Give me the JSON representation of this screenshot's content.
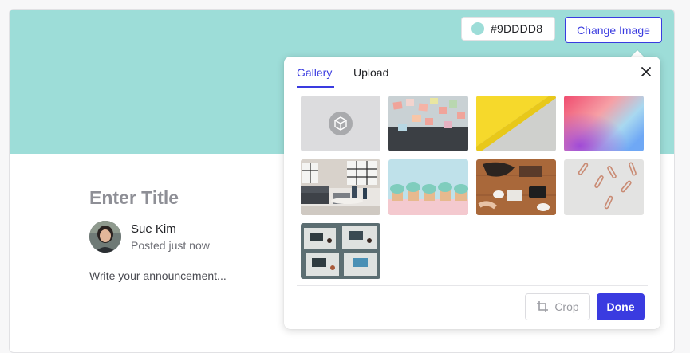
{
  "cover": {
    "color_hex": "#9DDDD8",
    "color_label": "#9DDDD8",
    "change_image_label": "Change Image"
  },
  "post": {
    "title_placeholder": "Enter Title",
    "author_name": "Sue Kim",
    "posted_time": "Posted just now",
    "body_placeholder": "Write your announcement..."
  },
  "picker": {
    "tabs": [
      {
        "label": "Gallery",
        "active": true
      },
      {
        "label": "Upload",
        "active": false
      }
    ],
    "thumbnails": [
      {
        "name": "no-image-placeholder",
        "icon": "cube-icon"
      },
      {
        "name": "sticky-notes-wall"
      },
      {
        "name": "yellow-concrete-diagonal"
      },
      {
        "name": "pink-blue-gradient"
      },
      {
        "name": "office-lounge"
      },
      {
        "name": "mint-cupcakes"
      },
      {
        "name": "coffee-table-devices"
      },
      {
        "name": "paper-clips"
      },
      {
        "name": "overhead-desks-laptops"
      }
    ],
    "crop_label": "Crop",
    "done_label": "Done",
    "close_icon": "close-icon"
  },
  "colors": {
    "accent": "#3A3BE0",
    "cover": "#9DDDD8"
  }
}
